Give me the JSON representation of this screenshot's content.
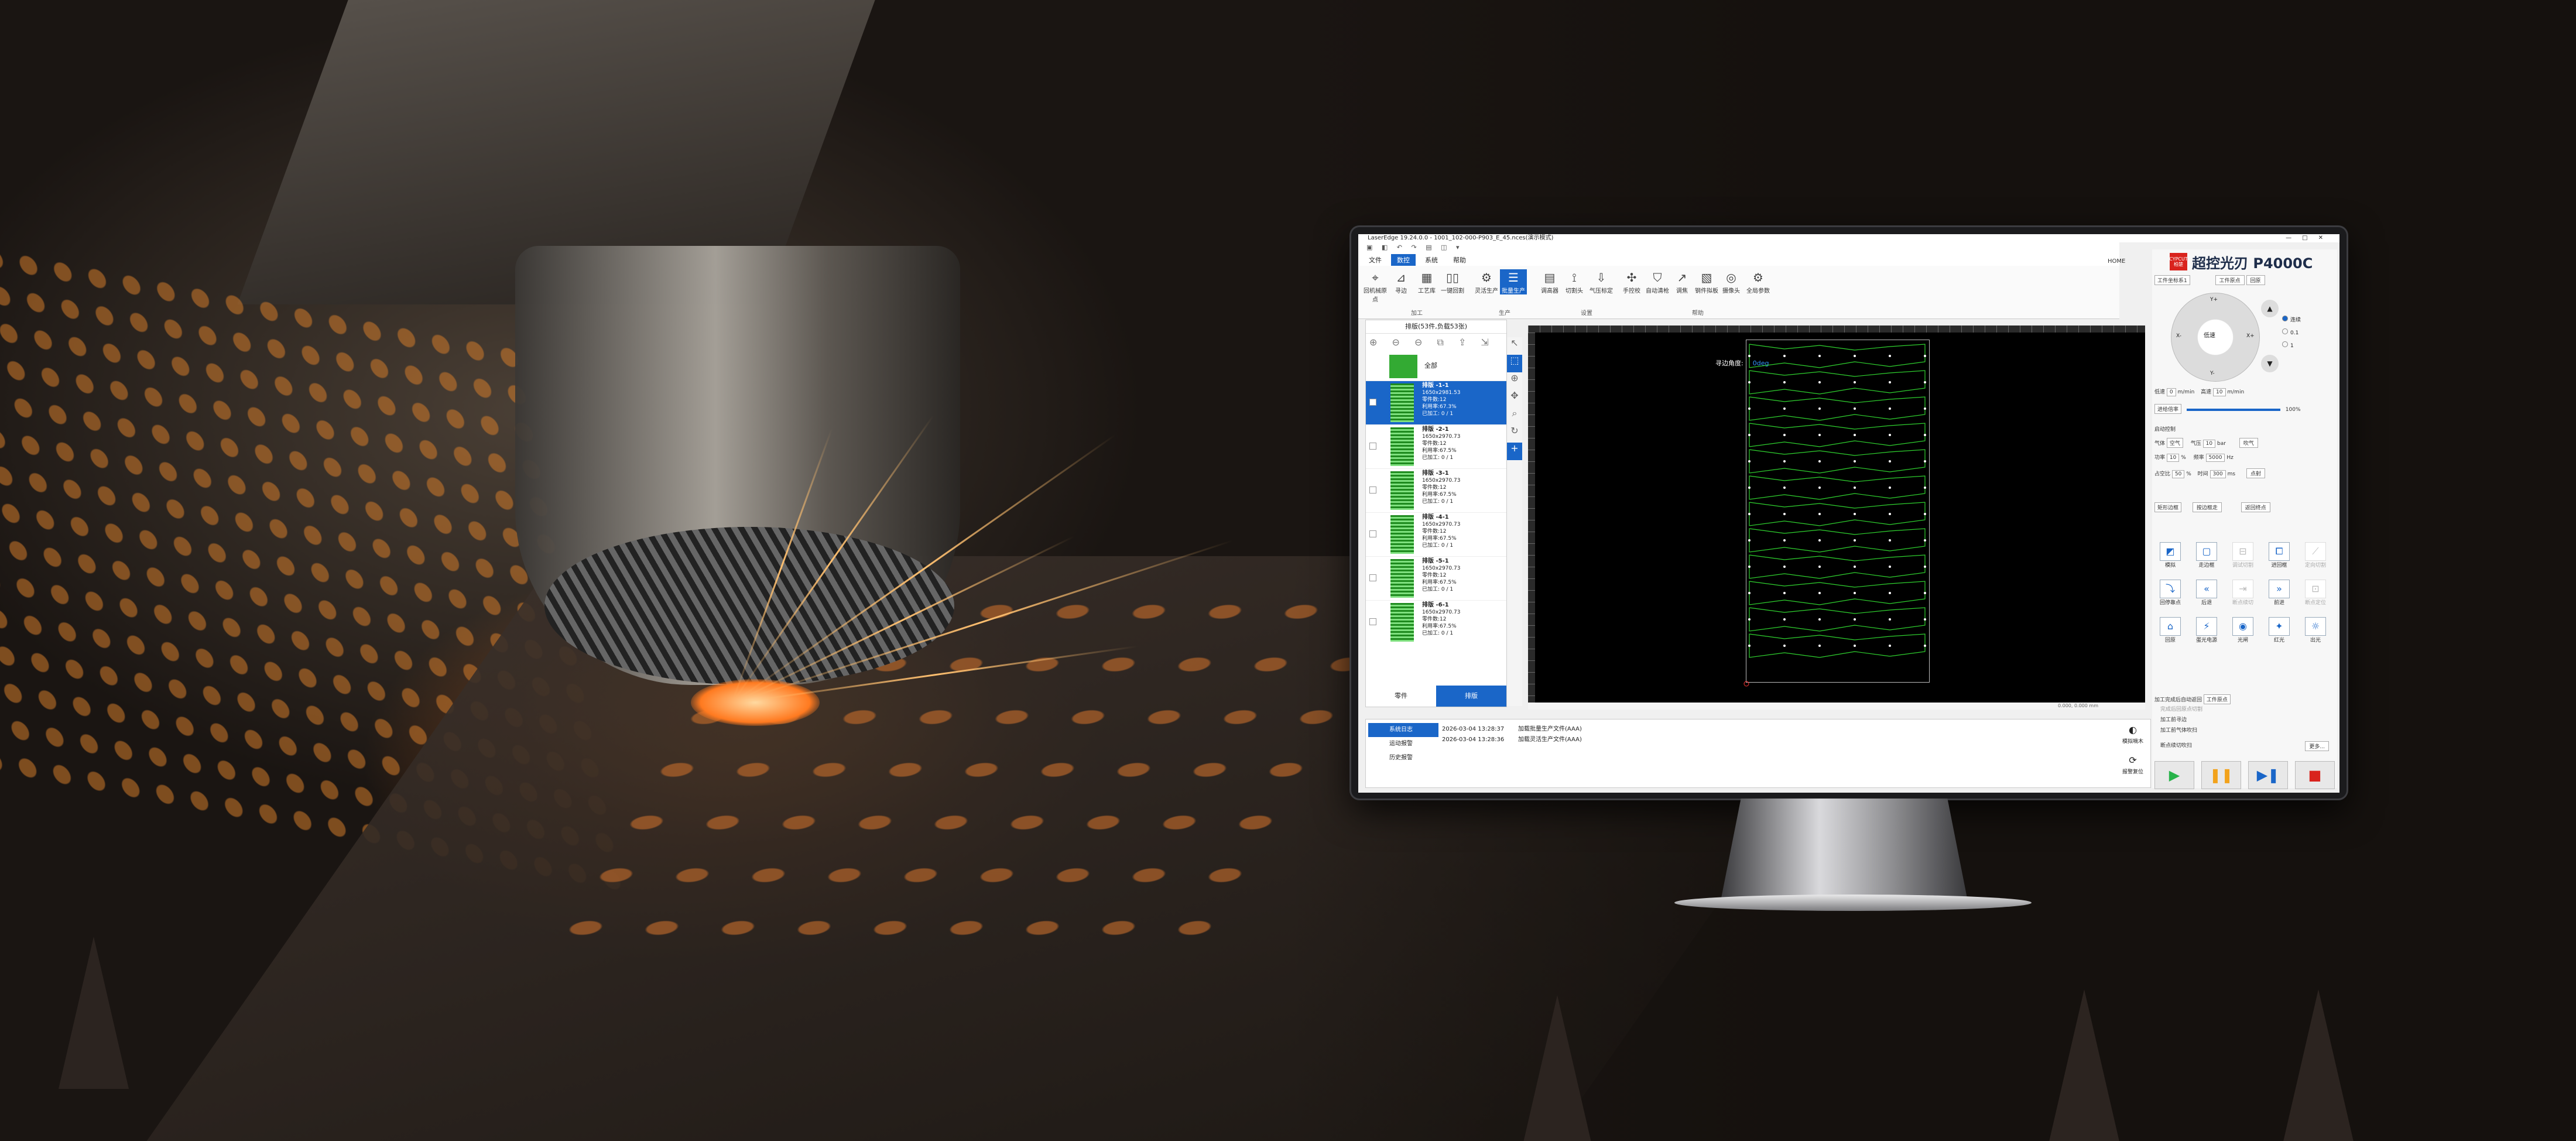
{
  "window": {
    "title": "LaserEdge 19.24.0.0 - 1001_102-000-P903_E_45.nces(演示模式)",
    "quick_access": "▣ ◧ ↶ ↷ ▤ ◫ ▾",
    "controls": "—□✕"
  },
  "menus": [
    "文件",
    "数控",
    "系统",
    "帮助"
  ],
  "ribbon": {
    "buttons": [
      {
        "label": "回机械原点",
        "icon": "⌖"
      },
      {
        "label": "寻边",
        "icon": "⊿"
      },
      {
        "label": "工艺库",
        "icon": "▦"
      },
      {
        "label": "一键回割",
        "icon": "▯▯"
      },
      {
        "label": "灵活生产",
        "icon": "⚙"
      },
      {
        "label": "批量生产",
        "icon": "☰"
      },
      {
        "label": "调高器",
        "icon": "▤"
      },
      {
        "label": "切割头",
        "icon": "⟟"
      },
      {
        "label": "气压标定",
        "icon": "⇩"
      },
      {
        "label": "手控校",
        "icon": "✣"
      },
      {
        "label": "自动清枪",
        "icon": "⛉"
      },
      {
        "label": "调焦",
        "icon": "↗"
      },
      {
        "label": "钢件拟板",
        "icon": "▧"
      },
      {
        "label": "摄像头",
        "icon": "◎"
      },
      {
        "label": "全局参数",
        "icon": "⚙"
      }
    ],
    "groups": [
      "加工",
      "生产",
      "设置",
      "帮助"
    ],
    "home": [
      "HOME",
      "管理"
    ]
  },
  "left_panel": {
    "header": "排版(53件,负载53张)",
    "tools": "⊕ ⊖ ⊖ ⧉ ⇪ ⇲",
    "all_label": "全部",
    "plates": [
      {
        "title": "排版 -1-1",
        "size": "1650x2981.53",
        "parts": "零件数:12",
        "util": "利用率:67.3%",
        "done": "已加工: 0 / 1"
      },
      {
        "title": "排版 -2-1",
        "size": "1650x2970.73",
        "parts": "零件数:12",
        "util": "利用率:67.5%",
        "done": "已加工: 0 / 1"
      },
      {
        "title": "排版 -3-1",
        "size": "1650x2970.73",
        "parts": "零件数:12",
        "util": "利用率:67.5%",
        "done": "已加工: 0 / 1"
      },
      {
        "title": "排版 -4-1",
        "size": "1650x2970.73",
        "parts": "零件数:12",
        "util": "利用率:67.5%",
        "done": "已加工: 0 / 1"
      },
      {
        "title": "排版 -5-1",
        "size": "1650x2970.73",
        "parts": "零件数:12",
        "util": "利用率:67.5%",
        "done": "已加工: 0 / 1"
      },
      {
        "title": "排版 -6-1",
        "size": "1650x2970.73",
        "parts": "零件数:12",
        "util": "利用率:67.5%",
        "done": "已加工: 0 / 1"
      }
    ],
    "tabs": [
      "零件",
      "排版"
    ]
  },
  "canvas": {
    "edge_label": "寻边角度:",
    "edge_value": "0deg",
    "status": "0.000, 0.000  mm"
  },
  "log": {
    "tabs": [
      "系统日志",
      "运动报警",
      "历史报警"
    ],
    "entries": [
      {
        "time": "2026-03-04 13:28:37",
        "msg": "加载批量生产文件(AAA)"
      },
      {
        "time": "2026-03-04 13:28:36",
        "msg": "加载灵活生产文件(AAA)"
      }
    ],
    "side_buttons": [
      {
        "label": "模拟嘀木",
        "icon": "◐"
      },
      {
        "label": "报警复位",
        "icon": "⟳"
      }
    ]
  },
  "right_panel": {
    "brand_logo": "CYPCUT\n柏楚",
    "brand_name": "超控光刃 P4000C",
    "coord_select": "工件坐标系1",
    "btn_workpiece": "工件原点",
    "btn_return": "回原",
    "jog": {
      "center": "低速",
      "up": "Y+",
      "down": "Y-",
      "left": "X-",
      "right": "X+"
    },
    "step_modes": [
      "连续",
      "0.1",
      "1"
    ],
    "speed_label": "低速",
    "speed_value": "0",
    "speed_unit": "m/min",
    "high_label": "高速",
    "high_value": "10",
    "high_unit": "m/min",
    "feed_label": "进给倍率",
    "feed_value": "100%",
    "laser_check": "启动控制",
    "gas_label": "气体",
    "gas_value": "空气",
    "pressure_label": "气压",
    "pressure_value": "10",
    "pressure_unit": "bar",
    "blow_btn": "吹气",
    "power_label": "功率",
    "power_value": "10",
    "power_pct": "%",
    "freq_label": "频率",
    "freq_value": "5000",
    "freq_unit": "Hz",
    "duty_label": "占空比",
    "duty_value": "50",
    "duty_pct": "%",
    "time_label": "时间",
    "time_value": "300",
    "time_unit": "ms",
    "pulse_btn": "点射",
    "frame_select": "矩形边框",
    "frame_btn": "按边框走",
    "return_btn": "返回终点",
    "grid_buttons": [
      {
        "label": "模拟",
        "icon": "◩",
        "on": true
      },
      {
        "label": "走边框",
        "icon": "▢",
        "on": true
      },
      {
        "label": "调试切割",
        "icon": "⊟",
        "on": false
      },
      {
        "label": "进回框",
        "icon": "⧠",
        "on": true
      },
      {
        "label": "定向切割",
        "icon": "⟋",
        "on": false
      },
      {
        "label": "回停靠点",
        "icon": "⤵",
        "on": true
      },
      {
        "label": "后退",
        "icon": "«",
        "on": true
      },
      {
        "label": "断点续切",
        "icon": "⇥",
        "on": false
      },
      {
        "label": "前进",
        "icon": "»",
        "on": true
      },
      {
        "label": "断点定位",
        "icon": "⊡",
        "on": false
      },
      {
        "label": "回原",
        "icon": "⌂",
        "on": true
      },
      {
        "label": "蛋光电源",
        "icon": "⚡",
        "on": true
      },
      {
        "label": "光闸",
        "icon": "◉",
        "on": true
      },
      {
        "label": "红光",
        "icon": "✦",
        "on": true
      },
      {
        "label": "出光",
        "icon": "☼",
        "on": true
      }
    ],
    "after_label": "加工完成后自动返回",
    "after_select": "工件原点",
    "opt1": "完成后回原点切割",
    "opt2": "加工前寻边",
    "opt3": "加工前气体吹扫",
    "opt4": "断点续切吹扫",
    "more_btn": "更多...",
    "run": {
      "start": "▶",
      "pause": "❚❚",
      "step": "▶❚",
      "stop": "■"
    },
    "colors": {
      "start": "#27b34a",
      "pause": "#f2a21b",
      "step": "#1a66c8",
      "stop": "#d9231d"
    }
  }
}
